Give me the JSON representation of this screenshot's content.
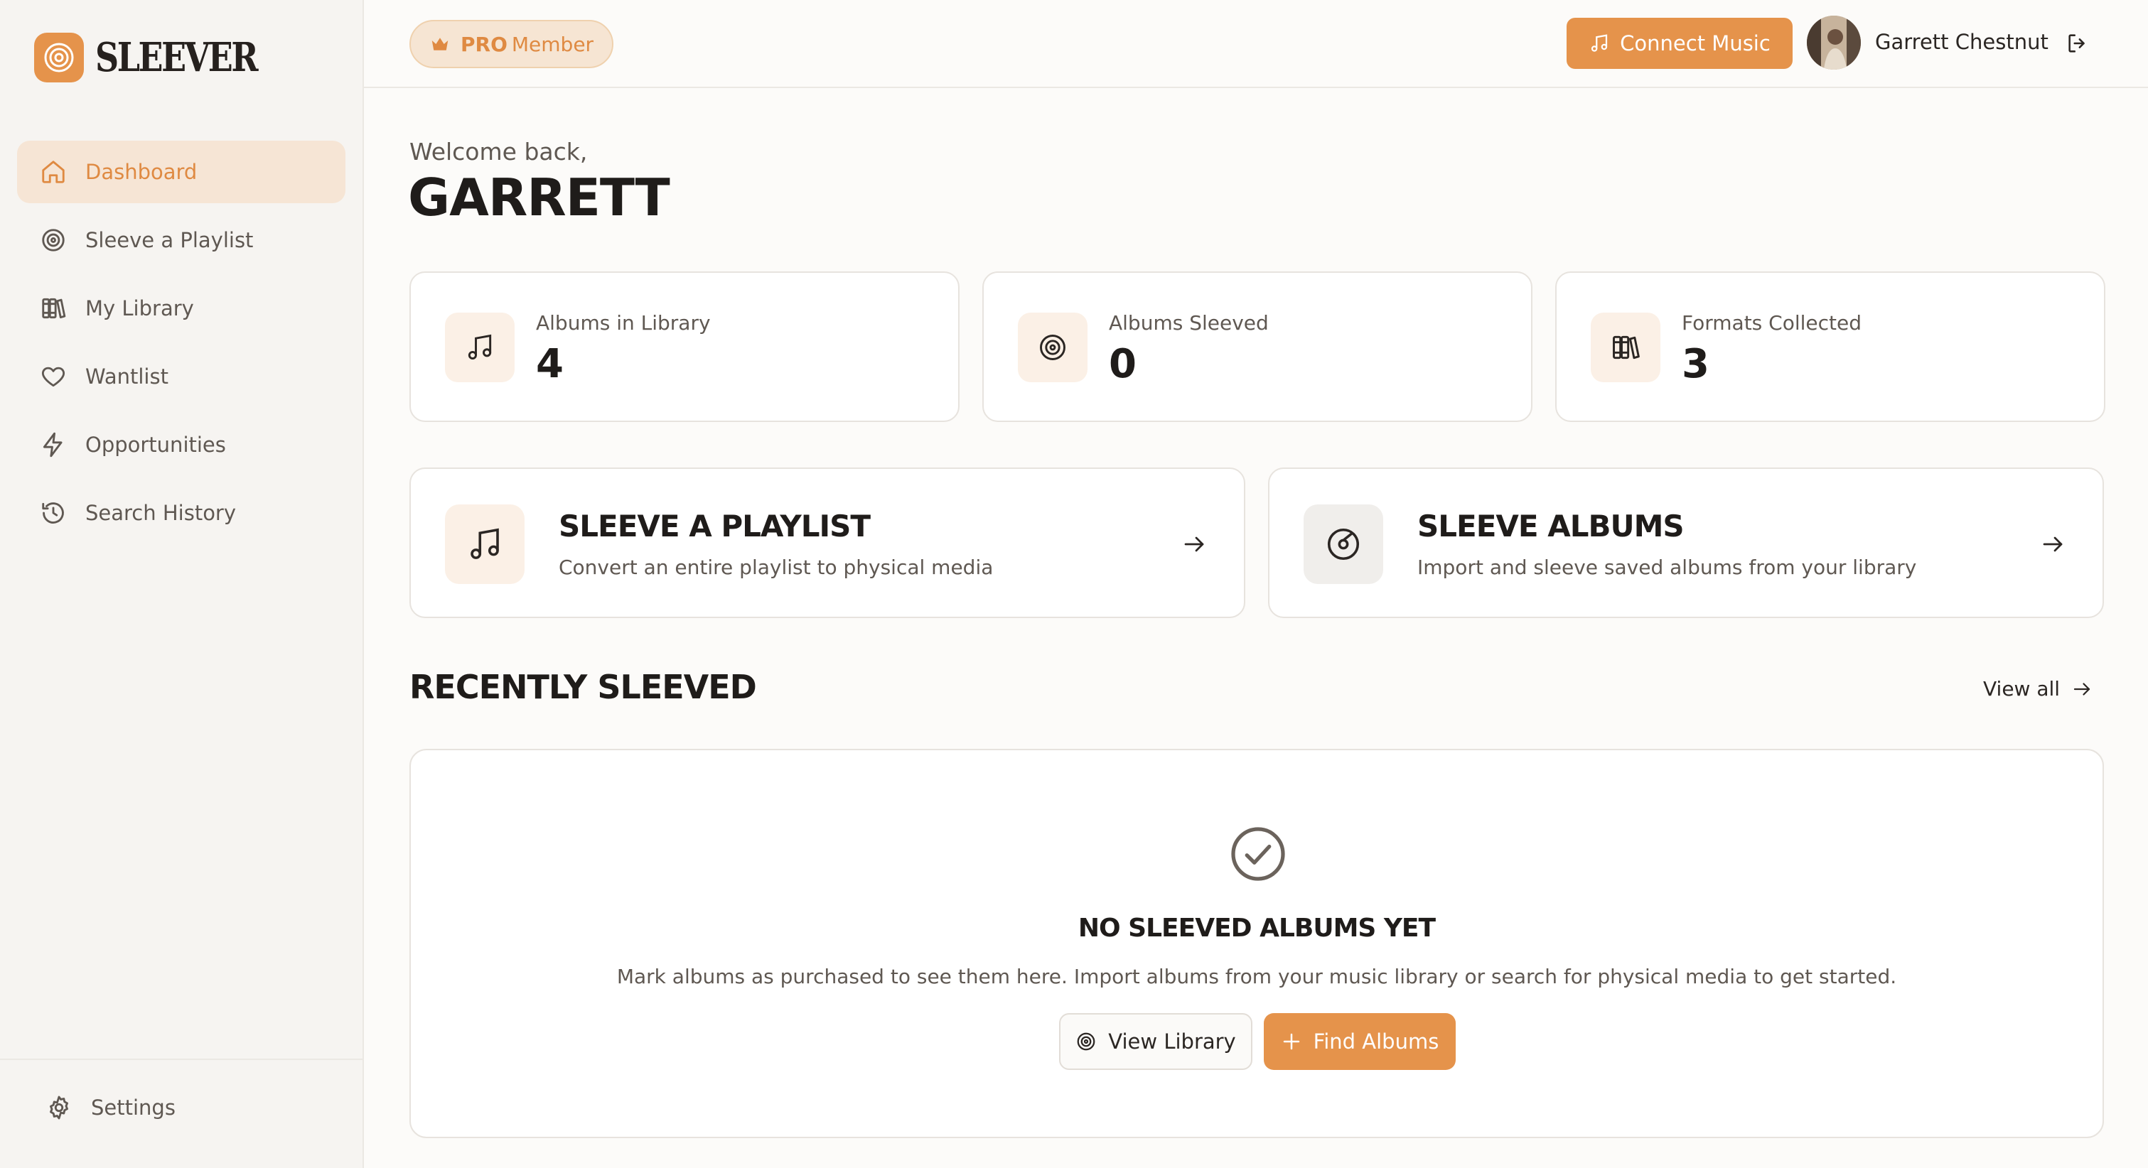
{
  "app": {
    "name": "SLEEVER"
  },
  "sidebar": {
    "items": [
      {
        "label": "Dashboard",
        "icon": "home-icon",
        "active": true
      },
      {
        "label": "Sleeve a Playlist",
        "icon": "target-disc-icon"
      },
      {
        "label": "My Library",
        "icon": "books-icon"
      },
      {
        "label": "Wantlist",
        "icon": "heart-icon"
      },
      {
        "label": "Opportunities",
        "icon": "lightning-icon"
      },
      {
        "label": "Search History",
        "icon": "history-icon"
      }
    ],
    "settings_label": "Settings"
  },
  "topbar": {
    "badge_pro": "PRO",
    "badge_member": "Member",
    "connect_label": "Connect Music",
    "user_name": "Garrett Chestnut"
  },
  "welcome": {
    "greeting": "Welcome back,",
    "name": "GARRETT"
  },
  "stats": [
    {
      "label": "Albums in Library",
      "value": "4",
      "icon": "music-note-icon"
    },
    {
      "label": "Albums Sleeved",
      "value": "0",
      "icon": "target-disc-icon"
    },
    {
      "label": "Formats Collected",
      "value": "3",
      "icon": "books-icon"
    }
  ],
  "actions": [
    {
      "title": "SLEEVE A PLAYLIST",
      "description": "Convert an entire playlist to physical media",
      "icon": "music-note-icon"
    },
    {
      "title": "SLEEVE ALBUMS",
      "description": "Import and sleeve saved albums from your library",
      "icon": "disc-icon"
    }
  ],
  "recent": {
    "title": "RECENTLY SLEEVED",
    "view_all": "View all",
    "empty_title": "NO SLEEVED ALBUMS YET",
    "empty_desc": "Mark albums as purchased to see them here. Import albums from your music library or search for physical media to get started.",
    "view_library": "View Library",
    "find_albums": "Find Albums"
  },
  "colors": {
    "accent": "#e5934b",
    "accent_light": "#f6e5d5",
    "background": "#fcfbf9",
    "sidebar": "#f6f4f1"
  }
}
